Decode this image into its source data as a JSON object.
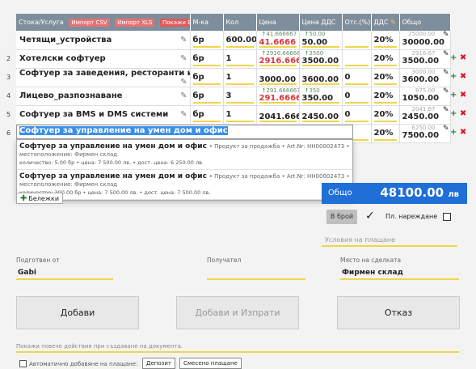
{
  "table": {
    "headers": {
      "product": "Стока/Услуга",
      "import_csv": "Импорт CSV",
      "import_xls": "Импорт XLS",
      "show_all": "Покажи Всички",
      "unit": "М-ка",
      "qty": "Кол",
      "price": "Цена",
      "price_vat": "Цена ДДС",
      "discount": "Отс.(%)",
      "vat": "ДДС",
      "total": "Общо"
    },
    "rows": [
      {
        "num": "",
        "name": "Четящи_устройства",
        "unit": "бр",
        "qty": "600.00",
        "price_hint": "41.666667",
        "price": "41.6666",
        "price_vat_hint": "50.00",
        "price_vat": "50.00",
        "discount": "",
        "vat": "20%",
        "total_hint": "25000.00",
        "total": "30000.00"
      },
      {
        "num": "2",
        "name": "Хотелски софтуер",
        "unit": "бр",
        "qty": "1",
        "price_hint": "2916.666667",
        "price": "2916.6666",
        "price_vat_hint": "3500",
        "price_vat": "3500.00",
        "discount": "",
        "vat": "20%",
        "total_hint": "2916.67",
        "total": "3500.00"
      },
      {
        "num": "3",
        "name": "Софтуер за заведения, ресторанти и магазини",
        "unit": "бр",
        "qty": "1",
        "price_hint": "",
        "price": "3000.00",
        "price_vat_hint": "",
        "price_vat": "3600.00",
        "discount": "0",
        "vat": "20%",
        "total_hint": "3000.00",
        "total": "3600.00"
      },
      {
        "num": "4",
        "name": "Лицево_разпознаване",
        "unit": "бр",
        "qty": "3",
        "price_hint": "291.666667",
        "price": "291.6666",
        "price_vat_hint": "350",
        "price_vat": "350.00",
        "discount": "0",
        "vat": "20%",
        "total_hint": "875.00",
        "total": "1050.00"
      },
      {
        "num": "5",
        "name": "Софтуер за BMS и DMS системи",
        "unit": "бр",
        "qty": "1",
        "price_hint": "",
        "price": "2041.6666",
        "price_vat_hint": "",
        "price_vat": "2450.00",
        "discount": "0",
        "vat": "20%",
        "total_hint": "2041.67",
        "total": "2450.00"
      },
      {
        "num": "6",
        "name": "",
        "unit": "",
        "qty": "",
        "price_hint": "",
        "price": "",
        "price_vat_hint": "",
        "price_vat": "",
        "discount": "",
        "vat": "20%",
        "total_hint": "6250.00",
        "total": "7500.00"
      }
    ]
  },
  "autocomplete": {
    "input_value": "Софтуер за управление на умен дом и офис",
    "items": [
      {
        "title": "Софтуер за управление на умен дом и офис",
        "meta": "• Продукт за продажба • Art.Nr: HH00002473 • местоположение: Фирмен склад",
        "sub": "количество: 5.00 бр • цена: 7 500.00 лв. • дост. цена: 6 250.00 лв."
      },
      {
        "title": "Софтуер за управление на умен дом и офис",
        "meta": "• Продукт за продажба • Art.Nr: HH00002473 • местоположение: Фирмен склад",
        "sub": "количество: 300.00 бр • цена: 7 500.00 лв. • дост. цена: 7 500.00 лв."
      }
    ]
  },
  "notes_label": "Бележки",
  "total": {
    "label": "Общо",
    "value": "48100.00",
    "currency": "лв"
  },
  "payment": {
    "cash_label": "В брой",
    "order_label": "Пл. нареждане",
    "terms_placeholder": "Условия на плащане"
  },
  "fields": {
    "prepared_by_label": "Подготвен от",
    "prepared_by_value": "Gabi",
    "receiver_label": "Получател",
    "receiver_value": "",
    "place_label": "Място на сделката",
    "place_value": "Фирмен склад"
  },
  "buttons": {
    "add": "Добави",
    "add_send": "Добави и Изпрати",
    "cancel": "Отказ"
  },
  "more_actions": "Покажи повече действия при създаване на документа.",
  "auto_add_label": "Автоматично добавяне на плащане:",
  "deposit_label": "Депозит",
  "mixed_label": "Смесено плащане"
}
